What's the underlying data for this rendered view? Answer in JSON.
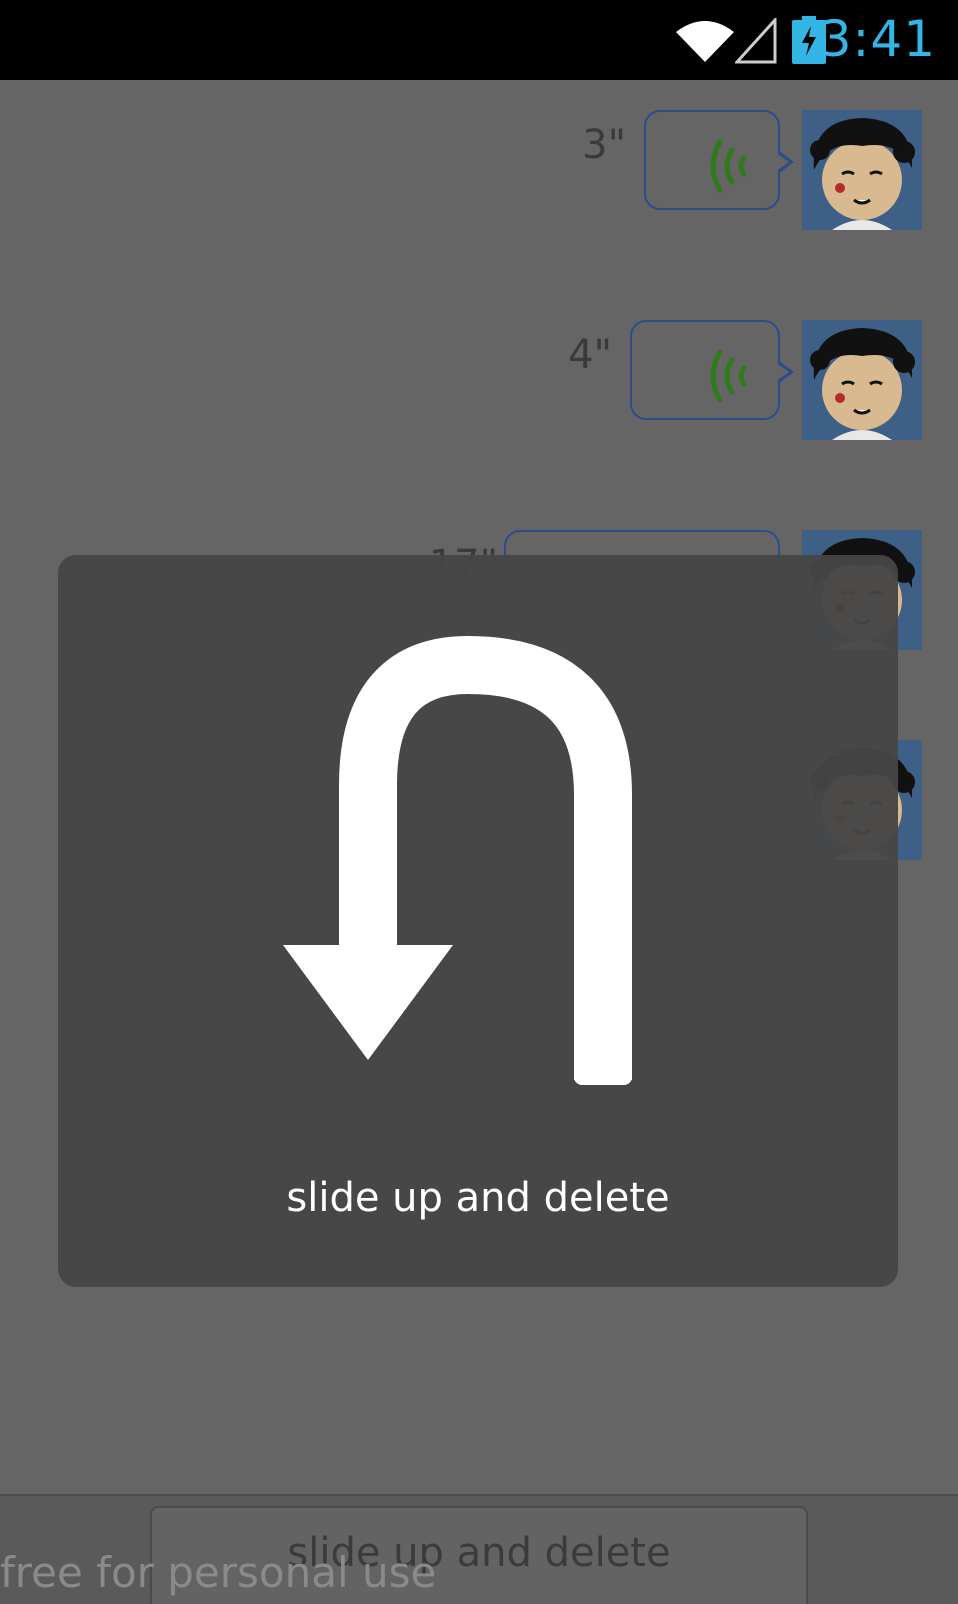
{
  "status_bar": {
    "time": "3:41",
    "icons": [
      "wifi-icon",
      "signal-icon",
      "battery-charging-icon"
    ],
    "time_color": "#33b5e5"
  },
  "messages": [
    {
      "duration": "3\""
    },
    {
      "duration": "4\""
    },
    {
      "duration": "17\""
    },
    {
      "duration": ""
    }
  ],
  "overlay": {
    "icon": "u-turn-arrow-icon",
    "text": "slide up and delete"
  },
  "bottom_bar": {
    "record_button_label": "slide up and delete"
  },
  "watermark": "free for personal use",
  "colors": {
    "bubble_border": "#2c4d8a",
    "voice_wave": "#2f7a1a",
    "avatar_bg": "#3e5f86"
  }
}
